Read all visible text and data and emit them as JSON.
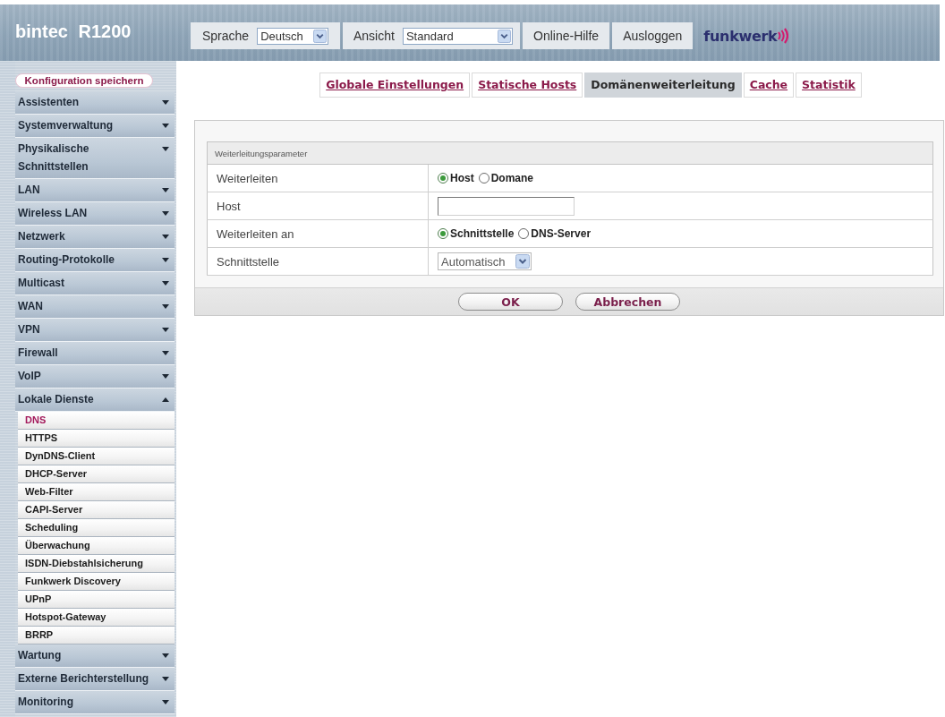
{
  "header": {
    "title": "bintec R1200",
    "language_label": "Sprache",
    "language": "Deutsch",
    "view_label": "Ansicht",
    "view": "Standard",
    "links": [
      "Online-Hilfe",
      "Ausloggen"
    ],
    "logo": "funkwerk"
  },
  "sidebar": {
    "save_button": "Konfiguration speichern",
    "items": [
      {
        "label": "Assistenten",
        "expanded": false
      },
      {
        "label": "Systemverwaltung",
        "expanded": false
      },
      {
        "label": "Physikalische Schnittstellen",
        "expanded": false
      },
      {
        "label": "LAN",
        "expanded": false
      },
      {
        "label": "Wireless LAN",
        "expanded": false
      },
      {
        "label": "Netzwerk",
        "expanded": false
      },
      {
        "label": "Routing-Protokolle",
        "expanded": false
      },
      {
        "label": "Multicast",
        "expanded": false
      },
      {
        "label": "WAN",
        "expanded": false
      },
      {
        "label": "VPN",
        "expanded": false
      },
      {
        "label": "Firewall",
        "expanded": false
      },
      {
        "label": "VoIP",
        "expanded": false
      },
      {
        "label": "Lokale Dienste",
        "expanded": true,
        "children": [
          {
            "label": "DNS",
            "selected": true
          },
          {
            "label": "HTTPS",
            "selected": false
          },
          {
            "label": "DynDNS-Client",
            "selected": false
          },
          {
            "label": "DHCP-Server",
            "selected": false
          },
          {
            "label": "Web-Filter",
            "selected": false
          },
          {
            "label": "CAPI-Server",
            "selected": false
          },
          {
            "label": "Scheduling",
            "selected": false
          },
          {
            "label": "Überwachung",
            "selected": false
          },
          {
            "label": "ISDN-Diebstahlsicherung",
            "selected": false
          },
          {
            "label": "Funkwerk Discovery",
            "selected": false
          },
          {
            "label": "UPnP",
            "selected": false
          },
          {
            "label": "Hotspot-Gateway",
            "selected": false
          },
          {
            "label": "BRRP",
            "selected": false
          }
        ]
      },
      {
        "label": "Wartung",
        "expanded": false
      },
      {
        "label": "Externe Berichterstellung",
        "expanded": false
      },
      {
        "label": "Monitoring",
        "expanded": false
      }
    ]
  },
  "tabs": [
    {
      "label": "Globale Einstellungen",
      "selected": false
    },
    {
      "label": "Statische Hosts",
      "selected": false
    },
    {
      "label": "Domänenweiterleitung",
      "selected": true
    },
    {
      "label": "Cache",
      "selected": false
    },
    {
      "label": "Statistik",
      "selected": false
    }
  ],
  "form": {
    "title": "Weiterleitungsparameter",
    "rows": [
      {
        "kind": "radio",
        "label": "Weiterleiten",
        "options": [
          {
            "label": "Host",
            "selected": true
          },
          {
            "label": "Domane",
            "selected": false
          }
        ]
      },
      {
        "kind": "input",
        "label": "Host"
      },
      {
        "kind": "radio",
        "label": "Weiterleiten an",
        "options": [
          {
            "label": "Schnittstelle",
            "selected": true
          },
          {
            "label": "DNS-Server",
            "selected": false
          }
        ]
      },
      {
        "kind": "select",
        "label": "Schnittstelle",
        "value": "Automatisch"
      }
    ]
  },
  "buttons": [
    {
      "label": "OK"
    },
    {
      "label": "Abbrechen"
    }
  ]
}
